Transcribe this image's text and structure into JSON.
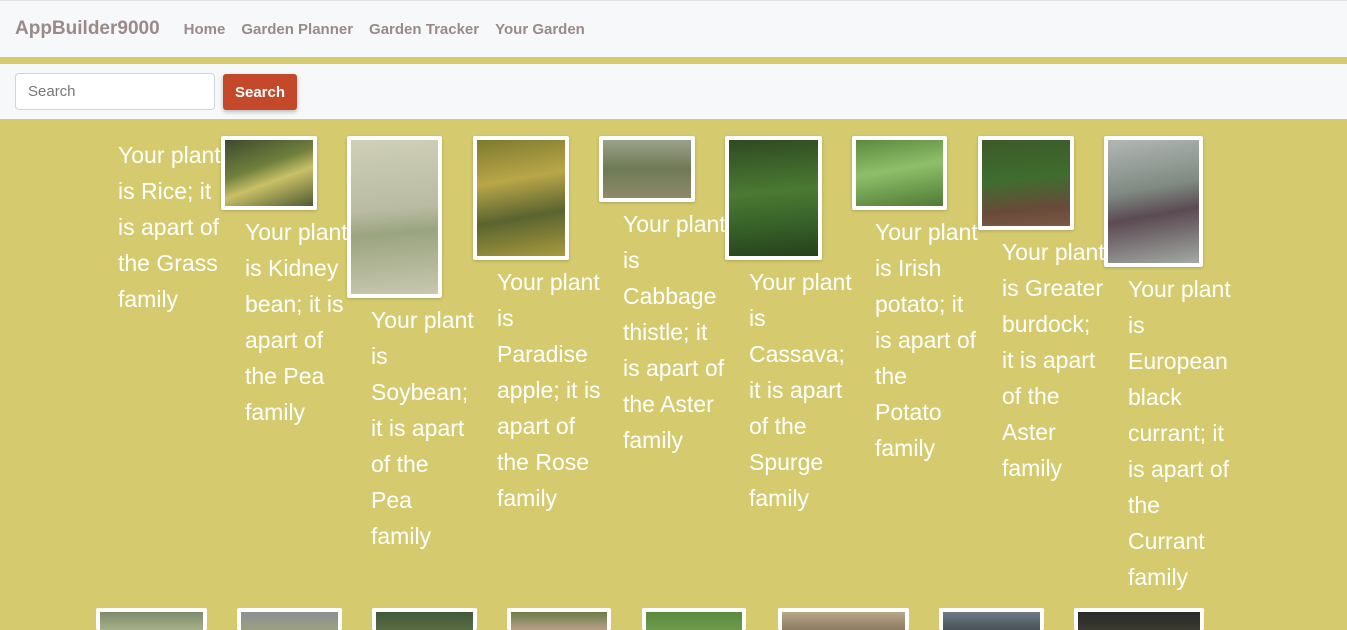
{
  "navbar": {
    "brand": "AppBuilder9000",
    "links": [
      "Home",
      "Garden Planner",
      "Garden Tracker",
      "Your Garden"
    ]
  },
  "search": {
    "placeholder": "Search",
    "button_label": "Search"
  },
  "plants": [
    {
      "caption": "Your plant is Rice; it is apart of the Grass family"
    },
    {
      "caption": "Your plant is Kidney bean; it is apart of the Pea family"
    },
    {
      "caption": "Your plant is Soybean; it is apart of the Pea family"
    },
    {
      "caption": "Your plant is Paradise apple; it is apart of the Rose family"
    },
    {
      "caption": "Your plant is Cabbage thistle; it is apart of the Aster family"
    },
    {
      "caption": "Your plant is Cassava; it is apart of the Spurge family"
    },
    {
      "caption": "Your plant is Irish potato; it is apart of the Potato family"
    },
    {
      "caption": "Your plant is Greater burdock; it is apart of the Aster family"
    },
    {
      "caption": "Your plant is European black currant; it is apart of the Currant family"
    }
  ],
  "colors": {
    "page_background": "#d5cb6e",
    "nav_background": "#f7f8f9",
    "search_button": "#c4482a",
    "nav_text": "#9a8a8a"
  }
}
